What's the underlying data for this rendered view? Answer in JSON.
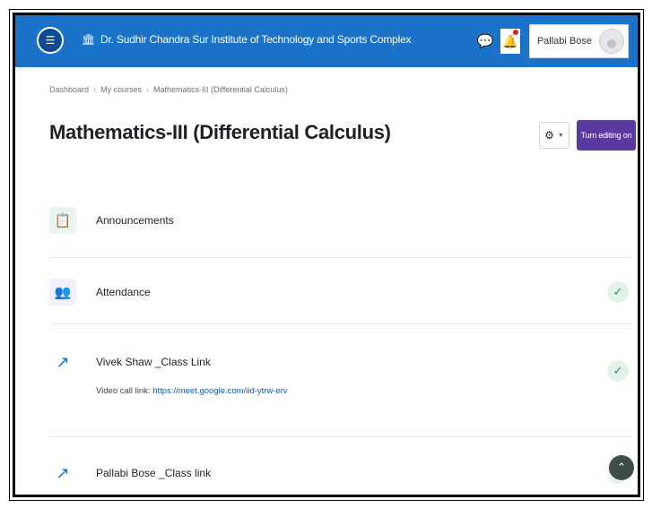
{
  "navbar": {
    "site_title": "Dr. Sudhir Chandra Sur Institute of Technology and Sports Complex",
    "user_name": "Pallabi Bose",
    "brand_color": "#1a73c8"
  },
  "breadcrumb": {
    "items": [
      "Dashboard",
      "My courses",
      "Mathematics-III (Differential Calculus)"
    ],
    "separator": "›"
  },
  "page": {
    "title": "Mathematics-III (Differential Calculus)",
    "edit_button_label": "Turn editing on",
    "edit_button_color": "#5b3aa0"
  },
  "activities": [
    {
      "name": "Announcements",
      "icon": "forum-icon",
      "completed": false
    },
    {
      "name": "Attendance",
      "icon": "attendance-icon",
      "completed": true
    },
    {
      "name": "Vivek Shaw _Class Link",
      "icon": "url-icon",
      "completed": true,
      "desc_prefix": "Video call link:",
      "desc_link": "https://meet.google.com/iid-ytrw-erv"
    },
    {
      "name": "Pallabi Bose _Class link",
      "icon": "url-icon",
      "completed": true
    }
  ]
}
